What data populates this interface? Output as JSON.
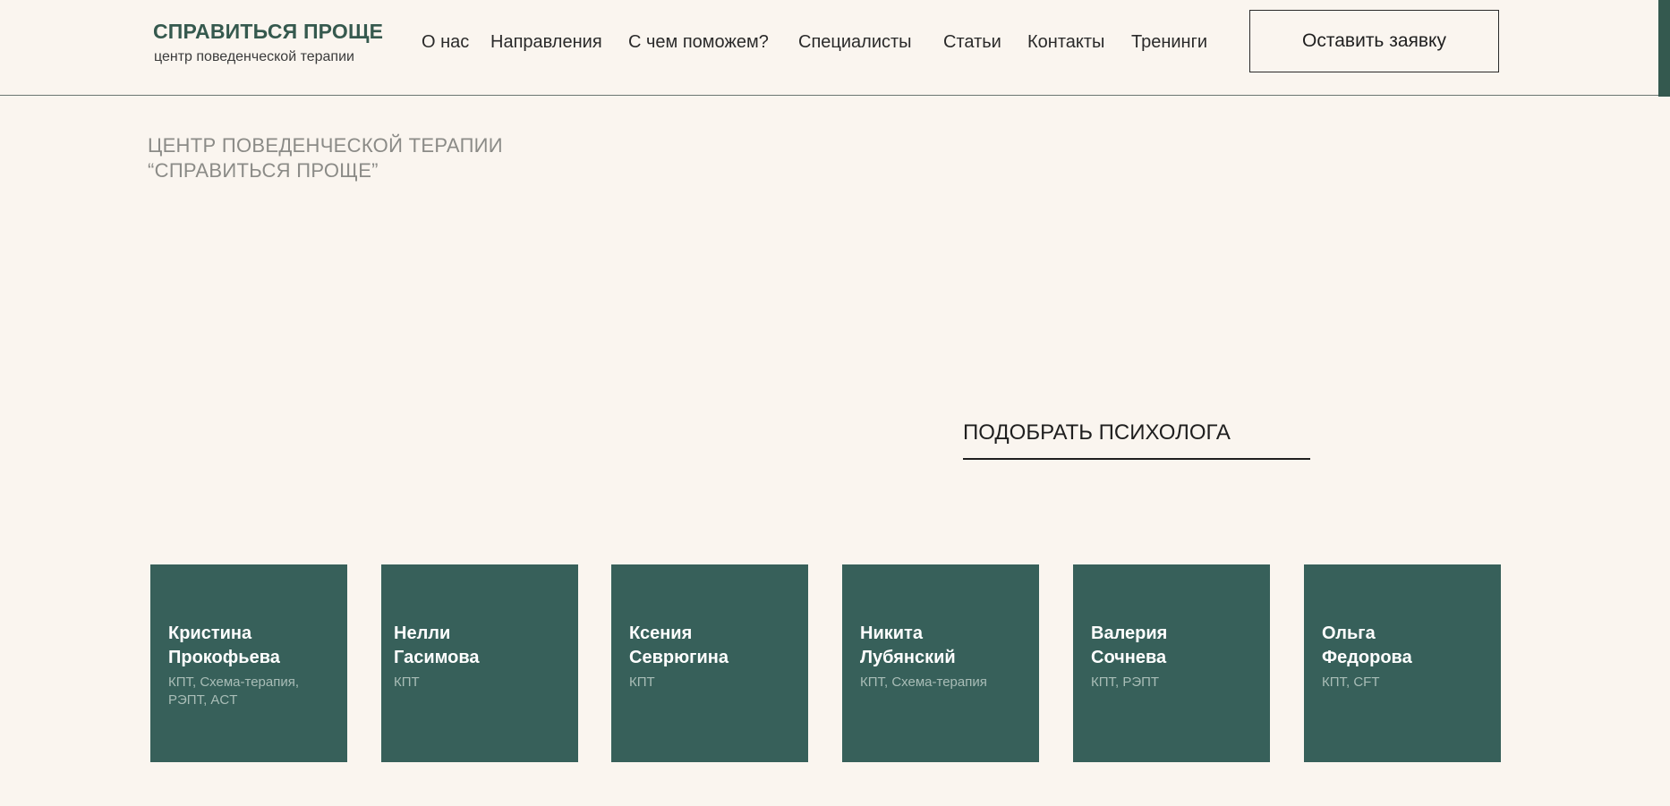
{
  "header": {
    "logo_title": "СПРАВИТЬСЯ ПРОЩЕ",
    "logo_subtitle": "центр поведенческой терапии",
    "nav": [
      {
        "label": "О нас"
      },
      {
        "label": "Направления"
      },
      {
        "label": "С чем поможем?"
      },
      {
        "label": "Специалисты"
      },
      {
        "label": "Статьи"
      },
      {
        "label": "Контакты"
      },
      {
        "label": "Тренинги"
      }
    ],
    "cta_label": "Оставить заявку"
  },
  "hero": {
    "line1": "ЦЕНТР ПОВЕДЕНЧЕСКОЙ ТЕРАПИИ",
    "line2": "“СПРАВИТЬСЯ ПРОЩЕ”"
  },
  "pick_psychologist_label": "ПОДОБРАТЬ ПСИХОЛОГА",
  "specialists": [
    {
      "first_name": "Кристина",
      "last_name": "Прокофьева",
      "specialties": "КПТ, Схема-терапия, РЭПТ, ACT"
    },
    {
      "first_name": "Нелли",
      "last_name": "Гасимова",
      "specialties": "КПТ"
    },
    {
      "first_name": "Ксения",
      "last_name": "Севрюгина",
      "specialties": "КПТ"
    },
    {
      "first_name": "Никита",
      "last_name": "Лубянский",
      "specialties": "КПТ, Схема-терапия"
    },
    {
      "first_name": "Валерия",
      "last_name": "Сочнева",
      "specialties": "КПТ, РЭПТ"
    },
    {
      "first_name": "Ольга",
      "last_name": "Федорова",
      "specialties": "КПТ, CFT"
    }
  ],
  "colors": {
    "background": "#faf5ef",
    "brand_green": "#35594e",
    "card_green": "#37605a",
    "card_spec_text": "#a9bdb7"
  }
}
